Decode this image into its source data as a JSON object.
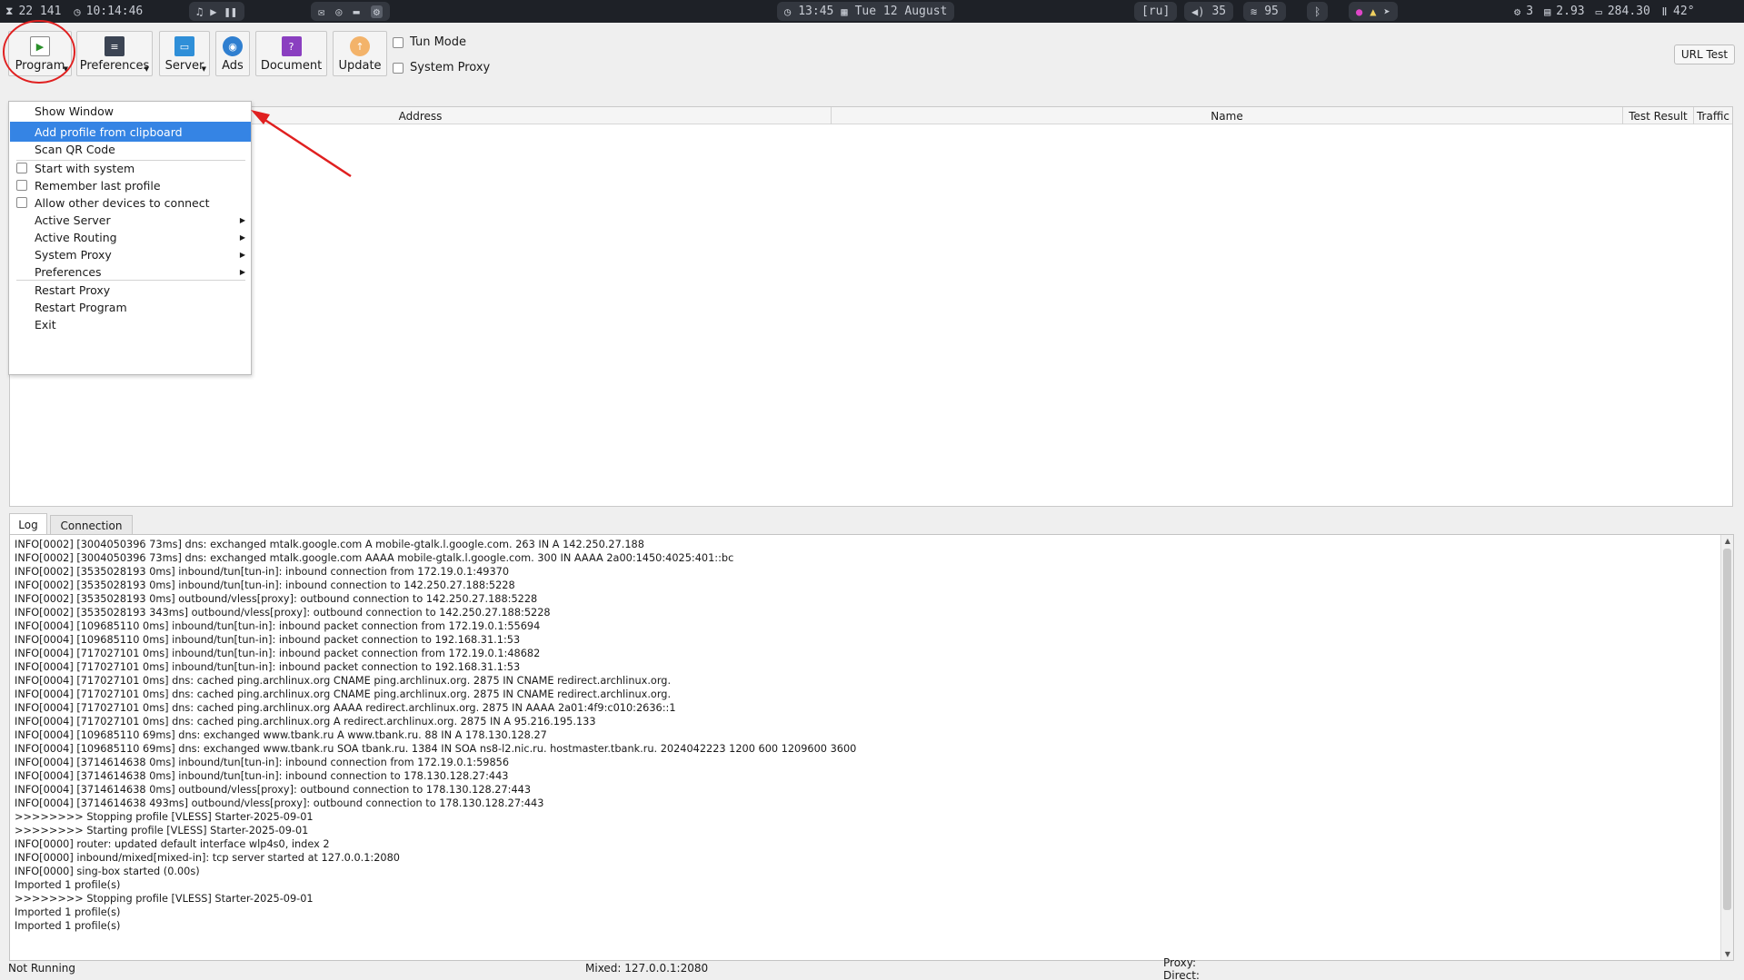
{
  "topbar": {
    "workspace_info": "22 141",
    "uptime": "10:14:46",
    "clock": "13:45",
    "date": "Tue 12 August",
    "layout": "[ru]",
    "volume": "35",
    "wifi": "95",
    "cpu": "3",
    "mem": "2.93",
    "disk": "284.30",
    "temp": "42°"
  },
  "toolbar": {
    "program": "Program",
    "preferences": "Preferences",
    "server": "Server",
    "ads": "Ads",
    "document": "Document",
    "update": "Update",
    "tun_mode": "Tun Mode",
    "system_proxy": "System Proxy",
    "url_test": "URL Test"
  },
  "table": {
    "columns": [
      "Address",
      "Name",
      "Test Result",
      "Traffic"
    ]
  },
  "menu": {
    "items": [
      {
        "label": "Show Window"
      },
      {
        "label": "Add profile from clipboard",
        "selected": true
      },
      {
        "label": "Scan QR Code"
      },
      {
        "label": "Start with system",
        "checkbox": true
      },
      {
        "label": "Remember last profile",
        "checkbox": true
      },
      {
        "label": "Allow other devices to connect",
        "checkbox": true
      },
      {
        "label": "Active Server",
        "submenu": true
      },
      {
        "label": "Active Routing",
        "submenu": true
      },
      {
        "label": "System Proxy",
        "submenu": true
      },
      {
        "label": "Preferences",
        "submenu": true
      },
      {
        "label": "Restart Proxy"
      },
      {
        "label": "Restart Program"
      },
      {
        "label": "Exit"
      }
    ]
  },
  "tabs": {
    "log": "Log",
    "connection": "Connection"
  },
  "log_lines": [
    "INFO[0002] [3004050396 73ms] dns: exchanged mtalk.google.com A mobile-gtalk.l.google.com. 263 IN A 142.250.27.188",
    "INFO[0002] [3004050396 73ms] dns: exchanged mtalk.google.com AAAA mobile-gtalk.l.google.com. 300 IN AAAA 2a00:1450:4025:401::bc",
    "INFO[0002] [3535028193 0ms] inbound/tun[tun-in]: inbound connection from 172.19.0.1:49370",
    "INFO[0002] [3535028193 0ms] inbound/tun[tun-in]: inbound connection to 142.250.27.188:5228",
    "INFO[0002] [3535028193 0ms] outbound/vless[proxy]: outbound connection to 142.250.27.188:5228",
    "INFO[0002] [3535028193 343ms] outbound/vless[proxy]: outbound connection to 142.250.27.188:5228",
    "INFO[0004] [109685110 0ms] inbound/tun[tun-in]: inbound packet connection from 172.19.0.1:55694",
    "INFO[0004] [109685110 0ms] inbound/tun[tun-in]: inbound packet connection to 192.168.31.1:53",
    "INFO[0004] [717027101 0ms] inbound/tun[tun-in]: inbound packet connection from 172.19.0.1:48682",
    "INFO[0004] [717027101 0ms] inbound/tun[tun-in]: inbound packet connection to 192.168.31.1:53",
    "INFO[0004] [717027101 0ms] dns: cached ping.archlinux.org CNAME ping.archlinux.org. 2875 IN CNAME redirect.archlinux.org.",
    "INFO[0004] [717027101 0ms] dns: cached ping.archlinux.org CNAME ping.archlinux.org. 2875 IN CNAME redirect.archlinux.org.",
    "INFO[0004] [717027101 0ms] dns: cached ping.archlinux.org AAAA redirect.archlinux.org. 2875 IN AAAA 2a01:4f9:c010:2636::1",
    "INFO[0004] [717027101 0ms] dns: cached ping.archlinux.org A redirect.archlinux.org. 2875 IN A 95.216.195.133",
    "INFO[0004] [109685110 69ms] dns: exchanged www.tbank.ru A www.tbank.ru. 88 IN A 178.130.128.27",
    "INFO[0004] [109685110 69ms] dns: exchanged www.tbank.ru SOA tbank.ru. 1384 IN SOA ns8-l2.nic.ru. hostmaster.tbank.ru. 2024042223 1200 600 1209600 3600",
    "INFO[0004] [3714614638 0ms] inbound/tun[tun-in]: inbound connection from 172.19.0.1:59856",
    "INFO[0004] [3714614638 0ms] inbound/tun[tun-in]: inbound connection to 178.130.128.27:443",
    "INFO[0004] [3714614638 0ms] outbound/vless[proxy]: outbound connection to 178.130.128.27:443",
    "INFO[0004] [3714614638 493ms] outbound/vless[proxy]: outbound connection to 178.130.128.27:443",
    ">>>>>>>> Stopping profile [VLESS] Starter-2025-09-01",
    ">>>>>>>> Starting profile [VLESS] Starter-2025-09-01",
    "INFO[0000] router: updated default interface wlp4s0, index 2",
    "INFO[0000] inbound/mixed[mixed-in]: tcp server started at 127.0.0.1:2080",
    "INFO[0000] sing-box started (0.00s)",
    "Imported 1 profile(s)",
    ">>>>>>>> Stopping profile [VLESS] Starter-2025-09-01",
    "Imported 1 profile(s)",
    "Imported 1 profile(s)"
  ],
  "status": {
    "state": "Not Running",
    "mixed": "Mixed: 127.0.0.1:2080",
    "proxy": "Proxy:",
    "direct": "Direct:"
  },
  "colors": {
    "menu_highlight": "#3584e4",
    "annotation": "#e02020",
    "topbar_bg": "#1e2127"
  }
}
